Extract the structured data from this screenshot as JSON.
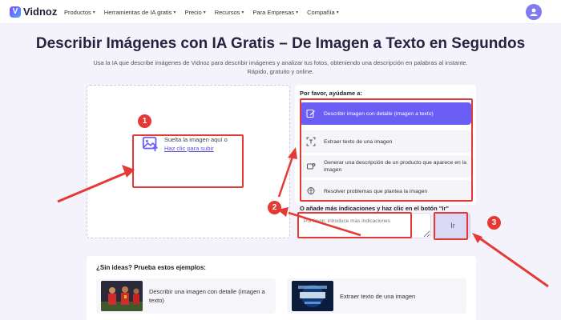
{
  "nav": {
    "logo_text": "Vidnoz",
    "items": [
      {
        "label": "Productos"
      },
      {
        "label": "Herramientas de IA gratis"
      },
      {
        "label": "Precio"
      },
      {
        "label": "Recursos"
      },
      {
        "label": "Para Empresas"
      },
      {
        "label": "Compañía"
      }
    ]
  },
  "hero": {
    "title": "Describir Imágenes con IA Gratis – De Imagen a Texto en Segundos",
    "subtitle": "Usa la IA que describe imágenes de Vidnoz para describir imágenes y analizar tus fotos, obteniendo una descripción en palabras al instante. Rápido, gratuito y online."
  },
  "upload": {
    "text": "Suelta la imagen aquí o",
    "link": "Haz clic para subir"
  },
  "panel": {
    "heading": "Por favor, ayúdame a:",
    "options": [
      {
        "label": "Describir imagen con detalle (imagen a texto)",
        "icon": "edit-icon",
        "active": true
      },
      {
        "label": "Extraer texto de una imagen",
        "icon": "text-scan-icon",
        "active": false
      },
      {
        "label": "Generar una descripción de un producto que aparece en la imagen",
        "icon": "product-icon",
        "active": false
      },
      {
        "label": "Resolver problemas que plantea la imagen",
        "icon": "brain-icon",
        "active": false
      }
    ]
  },
  "prompt": {
    "label": "O añade más indicaciones y haz clic en el botón \"Ir\"",
    "placeholder": "Por favor, introduce más indicaciones",
    "button": "Ir"
  },
  "ideas": {
    "heading": "¿Sin ideas? Prueba estos ejemplos:",
    "items": [
      {
        "label": "Describir una imagen con detalle (imagen a texto)",
        "image": "football-players-thumbnail"
      },
      {
        "label": "Extraer texto de una imagen",
        "image": "techno-night-poster-thumbnail"
      }
    ]
  },
  "annotations": {
    "badges": [
      "1",
      "2",
      "3"
    ],
    "color": "#e53935"
  },
  "colors": {
    "accent": "#6b5ef5",
    "background": "#f4f3fb"
  }
}
